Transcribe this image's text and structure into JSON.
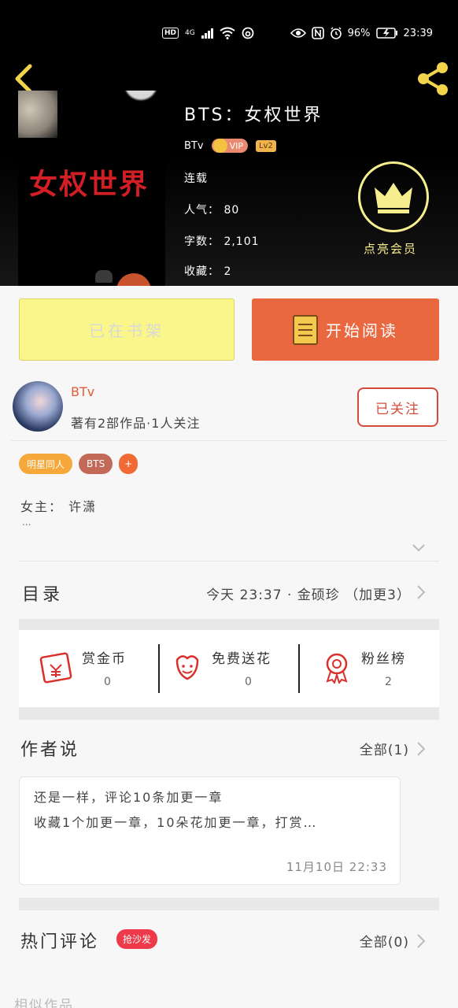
{
  "status_bar": {
    "hd": "HD",
    "network": "4G",
    "battery_percent": "96%",
    "time": "23:39"
  },
  "book": {
    "title": "BTS：女权世界",
    "cover_title": "女权世界",
    "author": "BTv",
    "vip": "VIP",
    "level": "Lv2",
    "status": "连载",
    "popularity": "人气： 80",
    "word_count": "字数： 2,101",
    "favorites": "收藏： 2"
  },
  "member": {
    "label": "点亮会员"
  },
  "buttons": {
    "shelf": "已在书架",
    "read": "开始阅读",
    "follow": "已关注"
  },
  "author_info": {
    "name": "BTv",
    "stats": "著有2部作品·1人关注"
  },
  "tags": [
    "明星同人",
    "BTS",
    "+"
  ],
  "synopsis": {
    "text": "女主： 许潇",
    "more": "..."
  },
  "toc": {
    "label": "目录",
    "latest": "今天 23:37 · 金硕珍 （加更3）"
  },
  "actions": [
    {
      "title": "赏金币",
      "count": "0",
      "icon": "red-envelope-icon"
    },
    {
      "title": "免费送花",
      "count": "0",
      "icon": "flower-icon"
    },
    {
      "title": "粉丝榜",
      "count": "2",
      "icon": "medal-icon"
    }
  ],
  "author_says": {
    "label": "作者说",
    "all": "全部(1)",
    "line1": "还是一样，评论10条加更一章",
    "line2": "收藏1个加更一章，10朵花加更一章，打赏…",
    "date": "11月10日   22:33"
  },
  "hot_comments": {
    "label": "热门评论",
    "badge": "抢沙发",
    "all": "全部(0)"
  },
  "similar": {
    "label": "相似作品"
  },
  "colors": {
    "accent_orange": "#e9683f",
    "shelf_yellow": "#fbf68a",
    "member_gold": "#f6ee8e",
    "author_red": "#e35a35"
  }
}
